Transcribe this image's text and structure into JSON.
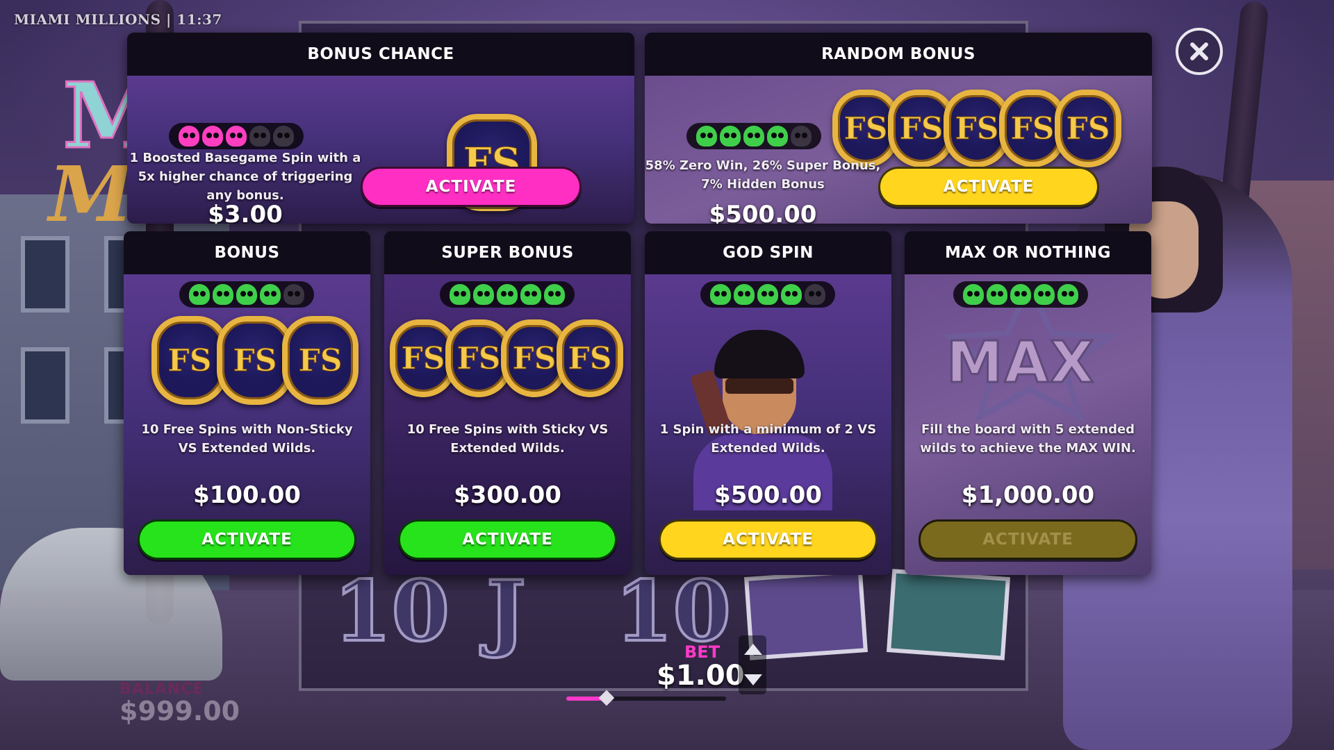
{
  "title_bar": "MIAMI MILLIONS | 11:37",
  "balance": {
    "label": "BALANCE",
    "value": "$999.00"
  },
  "bet": {
    "label": "BET",
    "value": "$1.00",
    "slider_level": 0.25
  },
  "reel_symbols": [
    "10",
    "J",
    "10"
  ],
  "cards": {
    "bonus_chance": {
      "title": "BONUS CHANCE",
      "level": 3,
      "max_level": 5,
      "level_color": "#ff3fc0",
      "badge_text": "FS",
      "description": "1 Boosted Basegame Spin with a 5x higher chance of triggering any bonus.",
      "price": "$3.00",
      "button": "ACTIVATE",
      "button_color": "#ff2fc4"
    },
    "random_bonus": {
      "title": "RANDOM BONUS",
      "level": 4,
      "max_level": 5,
      "level_color": "#3fcf4a",
      "badge_text": "FS",
      "description": "58% Zero Win, 26% Super Bonus, 7% Hidden Bonus",
      "price": "$500.00",
      "button": "ACTIVATE",
      "button_color": "#ffd51e"
    },
    "bonus": {
      "title": "BONUS",
      "level": 4,
      "max_level": 5,
      "level_color": "#3fcf4a",
      "badge_text": "FS",
      "description": "10 Free Spins with Non-Sticky VS Extended Wilds.",
      "price": "$100.00",
      "button": "ACTIVATE",
      "button_color": "#27e31c"
    },
    "super_bonus": {
      "title": "SUPER BONUS",
      "level": 5,
      "max_level": 5,
      "level_color": "#3fcf4a",
      "badge_text": "FS",
      "description": "10 Free Spins with Sticky VS Extended Wilds.",
      "price": "$300.00",
      "button": "ACTIVATE",
      "button_color": "#27e31c"
    },
    "god_spin": {
      "title": "GOD SPIN",
      "level": 4,
      "max_level": 5,
      "level_color": "#3fcf4a",
      "description": "1 Spin with a minimum of 2 VS Extended Wilds.",
      "price": "$500.00",
      "button": "ACTIVATE",
      "button_color": "#ffd51e"
    },
    "max_or_nothing": {
      "title": "MAX OR NOTHING",
      "level": 5,
      "max_level": 5,
      "level_color": "#3fcf4a",
      "art_text": "MAX",
      "description": "Fill the board with 5 extended wilds to achieve the MAX WIN.",
      "price": "$1,000.00",
      "button": "ACTIVATE",
      "button_state": "disabled"
    }
  },
  "icons": [
    "close-icon",
    "skull-icon",
    "fs-badge-icon",
    "arrow-up-icon",
    "arrow-down-icon"
  ]
}
